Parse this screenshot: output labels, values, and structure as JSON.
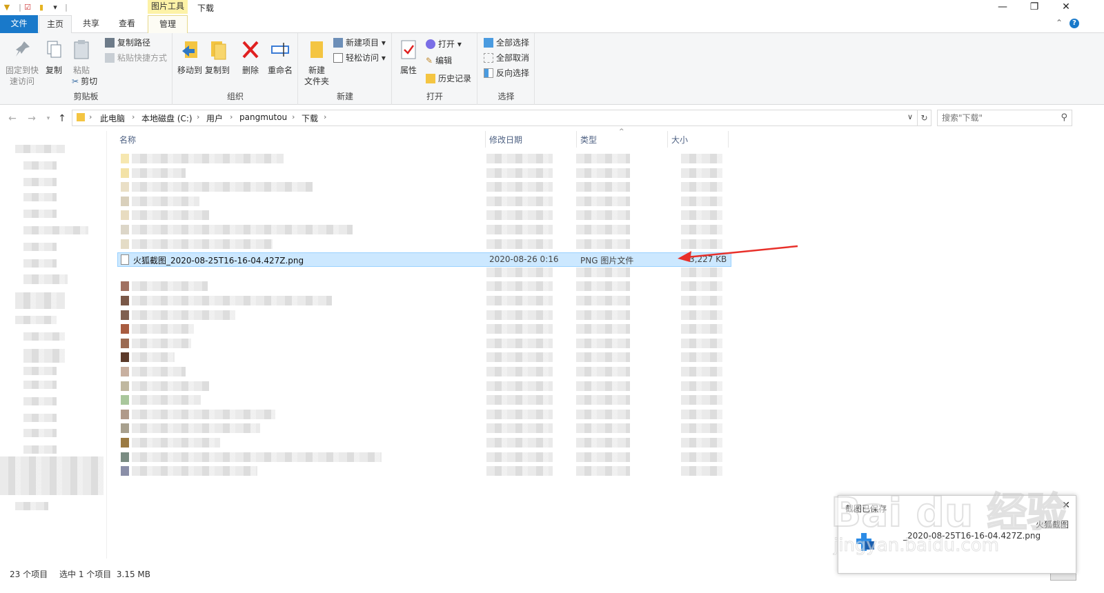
{
  "window": {
    "context_tab": "图片工具",
    "title": "下载",
    "minimize": "—",
    "restore": "❐",
    "close": "✕"
  },
  "tabs": [
    {
      "label": "文件"
    },
    {
      "label": "主页"
    },
    {
      "label": "共享"
    },
    {
      "label": "查看"
    },
    {
      "label": "管理"
    }
  ],
  "ribbon": {
    "clipboard": {
      "label": "剪贴板",
      "pin": "固定到快\n速访问",
      "copy": "复制",
      "paste": "粘贴",
      "copy_path": "复制路径",
      "paste_shortcut": "粘贴快捷方式",
      "cut": "剪切"
    },
    "organize": {
      "label": "组织",
      "move_to": "移动到",
      "copy_to": "复制到",
      "delete": "删除",
      "rename": "重命名"
    },
    "new": {
      "label": "新建",
      "new_folder": "新建\n文件夹",
      "new_item": "新建项目",
      "easy_access": "轻松访问"
    },
    "open": {
      "label": "打开",
      "properties": "属性",
      "open": "打开",
      "edit": "编辑",
      "history": "历史记录"
    },
    "select": {
      "label": "选择",
      "select_all": "全部选择",
      "select_none": "全部取消",
      "invert": "反向选择"
    }
  },
  "address": {
    "crumbs": [
      "此电脑",
      "本地磁盘 (C:)",
      "用户",
      "pangmutou",
      "下载"
    ],
    "search_placeholder": "搜索\"下载\""
  },
  "columns": {
    "name": "名称",
    "date": "修改日期",
    "type": "类型",
    "size": "大小"
  },
  "selected_file": {
    "name": "火狐截图_2020-08-25T16-16-04.427Z.png",
    "date": "2020-08-26 0:16",
    "type": "PNG 图片文件",
    "size": "3,227 KB"
  },
  "status": {
    "count": "23 个项目",
    "selection": "选中 1 个项目  3.15 MB"
  },
  "toast": {
    "title": "截图已保存",
    "body_line1": "火狐截图",
    "body_line2": "_2020-08-25T16-16-04.427Z.png"
  },
  "watermark": {
    "text": "Bai du 经验",
    "url": "jingyan.baidu.com"
  },
  "colors": {
    "file_tab": "#1979ca",
    "selection": "#cce8ff",
    "arrow": "#e8302a",
    "context_tab": "#fdf2a7"
  }
}
